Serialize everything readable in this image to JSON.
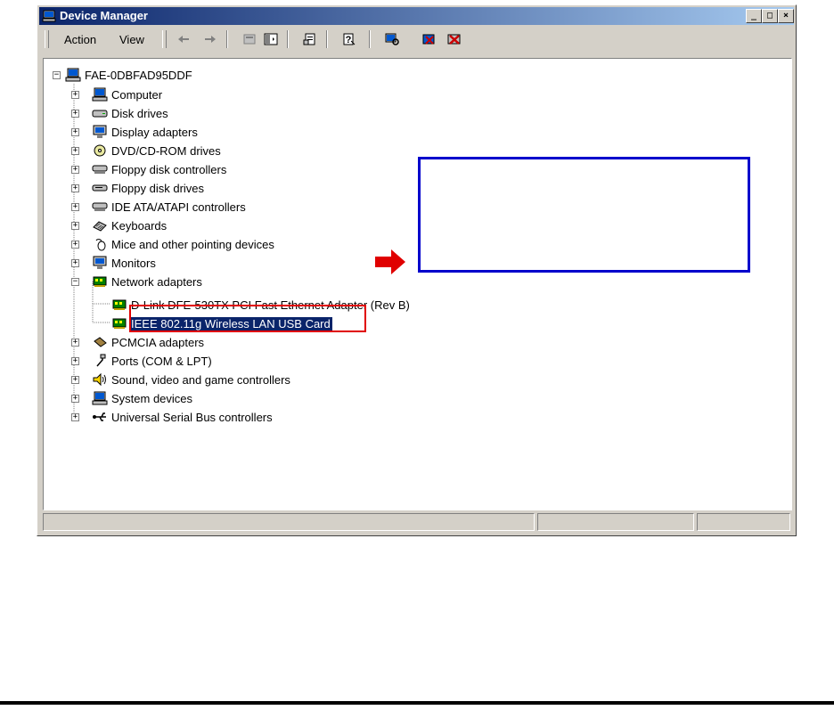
{
  "window": {
    "title": "Device Manager",
    "minimize": "_",
    "maximize": "□",
    "close": "×"
  },
  "toolbar": {
    "menu_action": "Action",
    "menu_view": "View"
  },
  "tree": {
    "root": "FAE-0DBFAD95DDF",
    "categories": [
      {
        "label": "Computer"
      },
      {
        "label": "Disk drives"
      },
      {
        "label": "Display adapters"
      },
      {
        "label": "DVD/CD-ROM drives"
      },
      {
        "label": "Floppy disk controllers"
      },
      {
        "label": "Floppy disk drives"
      },
      {
        "label": "IDE ATA/ATAPI controllers"
      },
      {
        "label": "Keyboards"
      },
      {
        "label": "Mice and other pointing devices"
      },
      {
        "label": "Monitors"
      },
      {
        "label": "Network adapters"
      },
      {
        "label": "PCMCIA adapters"
      },
      {
        "label": "Ports (COM & LPT)"
      },
      {
        "label": "Sound, video and game controllers"
      },
      {
        "label": "System devices"
      },
      {
        "label": "Universal Serial Bus controllers"
      }
    ],
    "network_children": [
      {
        "label": "D-Link DFE-530TX PCI Fast Ethernet Adapter (Rev B)"
      },
      {
        "label": "IEEE 802.11g Wireless LAN USB Card"
      }
    ]
  },
  "colors": {
    "selection": "#0a246a",
    "callout_border": "#0000cc",
    "highlight_red": "#e00000"
  }
}
